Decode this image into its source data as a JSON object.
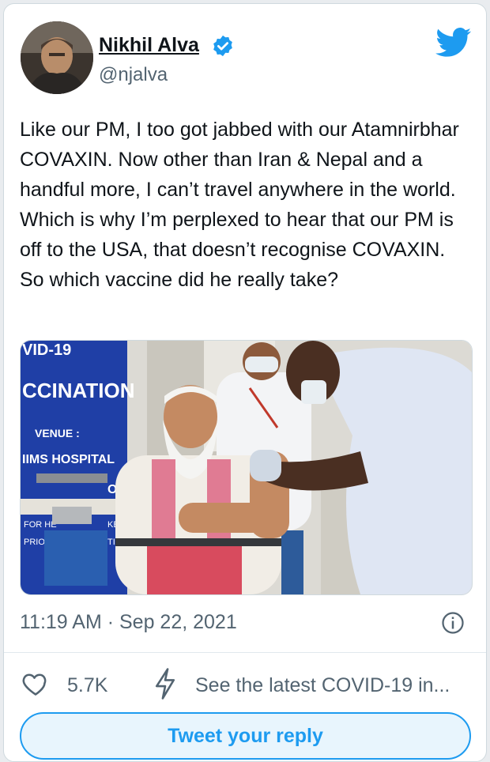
{
  "author": {
    "name": "Nikhil Alva",
    "handle": "@njalva"
  },
  "tweet": {
    "text": "Like our PM, I too got jabbed with our Atamnirbhar COVAXIN. Now other than Iran & Nepal and a handful more, I can’t travel anywhere in the world. Which is why I’m perplexed to hear that our PM is off to the USA, that doesn’t recognise COVAXIN. So which vaccine did he really take?",
    "timestamp": "11:19 AM · Sep 22, 2021"
  },
  "media": {
    "banner_text_1": "VID-19",
    "banner_text_2": "CCINATION",
    "banner_text_3": "VENUE :",
    "banner_text_4": "IIMS HOSPITAL",
    "banner_text_5": "OR",
    "banner_text_6": "FOR HE",
    "banner_text_7": "PRIOR",
    "banner_text_8": "KE",
    "banner_text_9": "TIC"
  },
  "actions": {
    "likes": "5.7K",
    "covid_notice": "See the latest COVID-19 in..."
  },
  "reply": {
    "label": "Tweet your reply"
  },
  "colors": {
    "accent": "#1d9bf0",
    "text": "#0f1419",
    "muted": "#536471"
  },
  "icons": {
    "verified": "verified-badge-icon",
    "twitter": "twitter-bird-icon",
    "info": "info-icon",
    "like": "heart-icon",
    "covid": "lightning-bolt-icon"
  }
}
